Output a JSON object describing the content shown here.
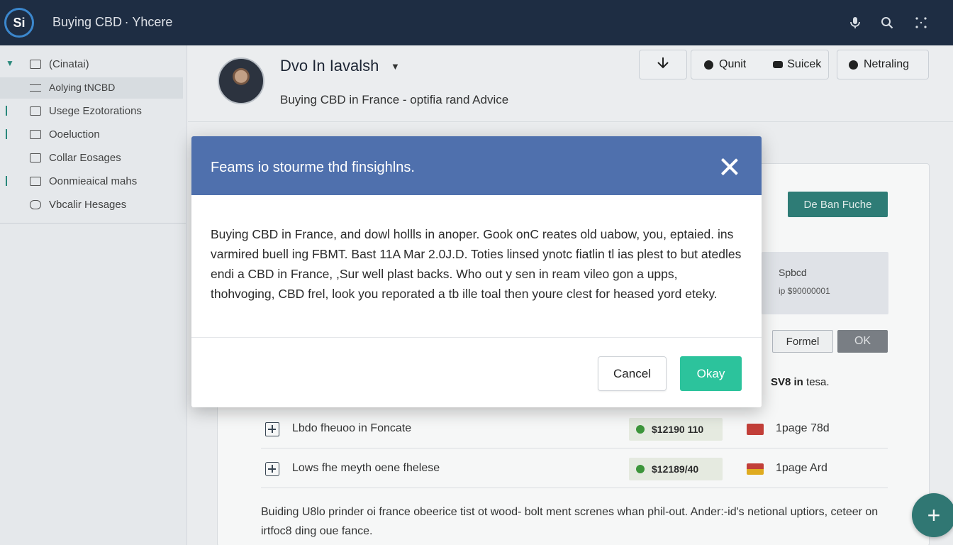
{
  "topbar": {
    "logo_text": "Si",
    "title": "Buying CBD · Yhcere",
    "icons": [
      "microphone-icon",
      "search-icon",
      "grid-icon"
    ]
  },
  "sidebar": {
    "items": [
      {
        "label": "(Cinatai)",
        "icon": "folder-icon"
      },
      {
        "label": "Aolying tNCBD",
        "icon": "list-icon"
      },
      {
        "label": "Usege Ezotorations",
        "icon": "folder-icon"
      },
      {
        "label": "Ooeluction",
        "icon": "folder-icon"
      },
      {
        "label": "Collar Eosages",
        "icon": "folder-icon"
      },
      {
        "label": "Oonmieaical mahs",
        "icon": "folder-icon"
      },
      {
        "label": "Vbcalir Hesages",
        "icon": "message-icon"
      }
    ]
  },
  "header": {
    "user_name": "Dvo In Iavalsh",
    "subtitle": "Buying CBD in France - optifia rand Advice",
    "buttons": {
      "download_icon": "download-icon",
      "qunit": "Qunit",
      "suicek": "Suicek",
      "netraling": "Netraling"
    }
  },
  "panel": {
    "teal_button": "De Ban Fuche",
    "info_line1": "Spbcd",
    "info_line2": "ip $90000001",
    "formel_button": "Formel",
    "ok_button": "OK",
    "total_bold": "SV8 in",
    "total_rest": " tesa."
  },
  "table": {
    "rows": [
      {
        "name": "Lbdo fheuoo in Foncate",
        "price": "$12190 110",
        "pages": "1page 78d",
        "flag_color": "#c9403a"
      },
      {
        "name": "Lows fhe meyth oene fhelese",
        "price": "$12189/40",
        "pages": "1page Ard",
        "flag_color": "#e0602a"
      }
    ]
  },
  "footer_text": "Buiding U8lo prinder oi france obeerice tist ot wood- bolt ment screnes whan phil-out. Ander:-id's netional uptiors, ceteer on irtfoc8 ding oue fance.",
  "modal": {
    "title": "Feams io stourme thd finsighlns.",
    "body": "Buying CBD in France, and dowl hollls in anoper. Gook onC reates old uabow, you, eptaied. ins varmired buell ing FBMT. Bast 11A Mar 2.0J.D. Toties linsed ynotc fiatlin tl ias plest to but atedles endi a CBD in France, ,Sur well plast backs. Who out y sen in ream vileo gon a upps, thohvoging, CBD frel, look you reporated a tb ille toal then youre clest for heased yord eteky.",
    "cancel_label": "Cancel",
    "okay_label": "Okay"
  },
  "fab": {
    "label": "+"
  },
  "colors": {
    "topbar": "#1f2d44",
    "modal_header": "#4f70ad",
    "accent_teal": "#2f7f79",
    "okay_green": "#2cc39c"
  }
}
